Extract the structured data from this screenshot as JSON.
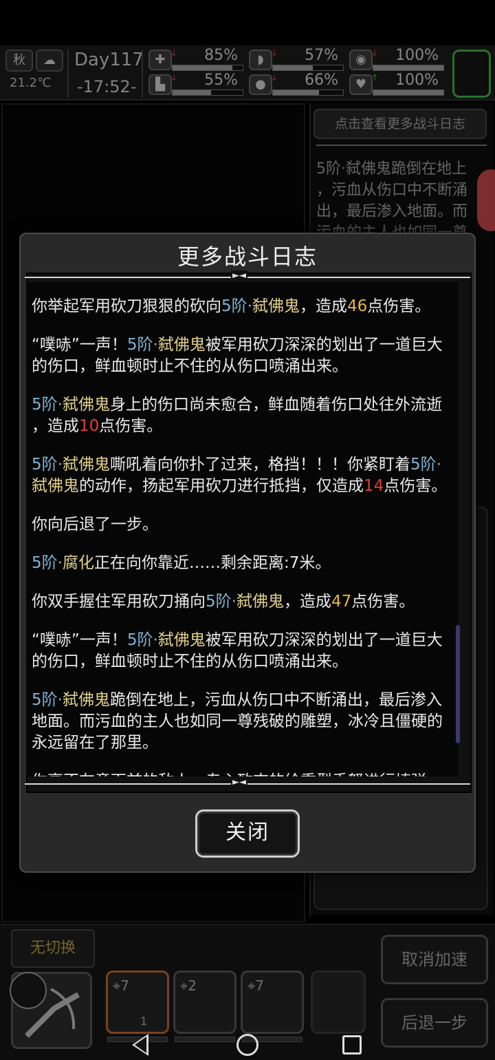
{
  "status": {
    "season": "秋",
    "weather_icon": "cloud-icon",
    "temperature": "21.2℃",
    "day": "Day117",
    "time": "-17:52-",
    "stats": [
      {
        "icon": "medkit-icon",
        "glyph": "✚",
        "value": "85%",
        "fraction": 0.85,
        "trend": "down"
      },
      {
        "icon": "stomach-icon",
        "glyph": "◗",
        "value": "57%",
        "fraction": 0.57,
        "trend": "down"
      },
      {
        "icon": "mind-icon",
        "glyph": "◉",
        "value": "100%",
        "fraction": 1.0,
        "trend": "down"
      },
      {
        "icon": "boot-icon",
        "glyph": "▙",
        "value": "55%",
        "fraction": 0.55,
        "trend": "down"
      },
      {
        "icon": "water-drop-icon",
        "glyph": "●",
        "value": "66%",
        "fraction": 0.66,
        "trend": "down"
      },
      {
        "icon": "heart-icon",
        "glyph": "♥",
        "value": "100%",
        "fraction": 1.0,
        "trend": "up"
      }
    ]
  },
  "side": {
    "log_link": "点击查看更多战斗日志",
    "log_lines": [
      "5阶·弑佛鬼跪倒在地上",
      "，污血从伤口中不断涌",
      "出，最后渗入地面。而",
      "污血的主人也如同一尊"
    ]
  },
  "dialog": {
    "title": "更多战斗日志",
    "close_label": "关闭",
    "entries": [
      {
        "lines": [
          [
            {
              "t": "你举起军用砍刀狠狠的砍向"
            },
            {
              "t": "5阶·",
              "c": "blue"
            },
            {
              "t": "弑佛鬼",
              "c": "yellow"
            },
            {
              "t": "，造成"
            },
            {
              "t": "46",
              "c": "gold"
            },
            {
              "t": "点伤害。"
            }
          ]
        ]
      },
      {
        "lines": [
          [
            {
              "t": "“噗哧”一声！"
            },
            {
              "t": "5阶·",
              "c": "blue"
            },
            {
              "t": "弑佛鬼",
              "c": "yellow"
            },
            {
              "t": "被军用砍刀深深的划出了一道巨大"
            }
          ],
          [
            {
              "t": "的伤口，鲜血顿时止不住的从伤口喷涌出来。"
            }
          ]
        ]
      },
      {
        "lines": [
          [
            {
              "t": "5阶·",
              "c": "blue"
            },
            {
              "t": "弑佛鬼",
              "c": "yellow"
            },
            {
              "t": "身上的伤口尚未愈合，鲜血随着伤口处往外流逝"
            }
          ],
          [
            {
              "t": "，造成"
            },
            {
              "t": "10",
              "c": "red"
            },
            {
              "t": "点伤害。"
            }
          ]
        ]
      },
      {
        "lines": [
          [
            {
              "t": "5阶·",
              "c": "blue"
            },
            {
              "t": "弑佛鬼",
              "c": "yellow"
            },
            {
              "t": "嘶吼着向你扑了过来，格挡！！！你紧盯着"
            },
            {
              "t": "5阶·",
              "c": "blue"
            }
          ],
          [
            {
              "t": "弑佛鬼",
              "c": "yellow"
            },
            {
              "t": "的动作，扬起军用砍刀进行抵挡，仅造成"
            },
            {
              "t": "14",
              "c": "red"
            },
            {
              "t": "点伤害。"
            }
          ]
        ]
      },
      {
        "lines": [
          [
            {
              "t": "你向后退了一步。"
            }
          ]
        ]
      },
      {
        "lines": [
          [
            {
              "t": "5阶·",
              "c": "blue"
            },
            {
              "t": "腐化",
              "c": "yellow"
            },
            {
              "t": "正在向你靠近……剩余距离:7米。"
            }
          ]
        ]
      },
      {
        "lines": [
          [
            {
              "t": "你双手握住军用砍刀捅向"
            },
            {
              "t": "5阶·",
              "c": "blue"
            },
            {
              "t": "弑佛鬼",
              "c": "yellow"
            },
            {
              "t": "，造成"
            },
            {
              "t": "47",
              "c": "gold"
            },
            {
              "t": "点伤害。"
            }
          ]
        ]
      },
      {
        "lines": [
          [
            {
              "t": "“噗哧”一声！"
            },
            {
              "t": "5阶·",
              "c": "blue"
            },
            {
              "t": "弑佛鬼",
              "c": "yellow"
            },
            {
              "t": "被军用砍刀深深的划出了一道巨大"
            }
          ],
          [
            {
              "t": "的伤口，鲜血顿时止不住的从伤口喷涌出来。"
            }
          ]
        ]
      },
      {
        "lines": [
          [
            {
              "t": "5阶·",
              "c": "blue"
            },
            {
              "t": "弑佛鬼",
              "c": "yellow"
            },
            {
              "t": "跪倒在地上，污血从伤口中不断涌出，最后渗入"
            }
          ],
          [
            {
              "t": "地面。而污血的主人也如同一尊残破的雕塑，冰冷且僵硬的"
            }
          ],
          [
            {
              "t": "永远留在了那里。"
            }
          ]
        ]
      },
      {
        "lines": [
          [
            {
              "t": "你毫不在意面前的敌人，专心致志的给重型手弩进行填弹"
            }
          ]
        ]
      }
    ]
  },
  "bottom": {
    "no_switch": "无切换",
    "slots": [
      {
        "count": "7",
        "sub": "1",
        "icon": "machete-icon"
      },
      {
        "count": "2",
        "icon": "blade-icon"
      },
      {
        "count": "7",
        "icon": "net-icon"
      }
    ],
    "cancel_speedup": "取消加速",
    "step_back": "后退一步"
  }
}
